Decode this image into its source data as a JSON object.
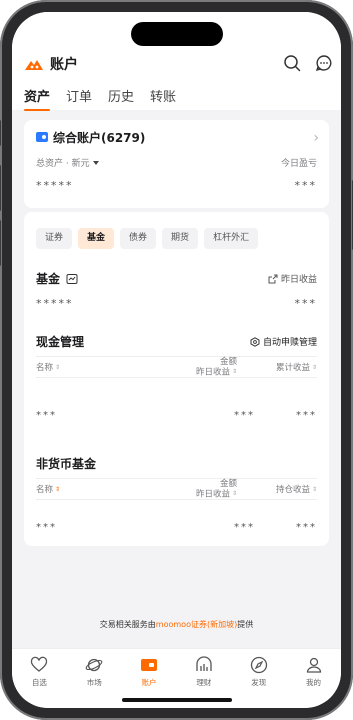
{
  "header": {
    "title": "账户"
  },
  "tabs": [
    {
      "label": "资产",
      "active": true
    },
    {
      "label": "订单"
    },
    {
      "label": "历史"
    },
    {
      "label": "转账"
    }
  ],
  "account": {
    "name": "综合账户(6279)",
    "total_label": "总资产 · 新元",
    "today_pl_label": "今日盈亏",
    "total_value": "*****",
    "today_value": "***"
  },
  "chips": [
    "证券",
    "基金",
    "债券",
    "期货",
    "杠杆外汇"
  ],
  "fund": {
    "title": "基金",
    "yesterday_label": "昨日收益",
    "total_value": "*****",
    "yesterday_value": "***"
  },
  "cash": {
    "title": "现金管理",
    "action": "自动申赎管理",
    "col_name": "名称",
    "col_amount": "金额",
    "col_yesterday": "昨日收益",
    "col_cum": "累计收益",
    "row": {
      "name": "***",
      "amount": "***",
      "cum": "***"
    }
  },
  "nonmoney": {
    "title": "非货币基金",
    "col_name": "名称",
    "col_amount": "金额",
    "col_yesterday": "昨日收益",
    "col_hold": "持仓收益",
    "row": {
      "name": "***",
      "amount": "***",
      "hold": "***"
    }
  },
  "footer": {
    "pre": "交易相关服务由",
    "link": "moomoo证券(新加坡)",
    "post": "提供"
  },
  "tabbar": [
    {
      "label": "自选",
      "icon": "heart-icon"
    },
    {
      "label": "市场",
      "icon": "planet-icon"
    },
    {
      "label": "账户",
      "icon": "account-icon",
      "active": true
    },
    {
      "label": "理财",
      "icon": "wealth-icon"
    },
    {
      "label": "发现",
      "icon": "compass-icon"
    },
    {
      "label": "我的",
      "icon": "person-icon"
    }
  ],
  "colors": {
    "accent": "#ff6a00",
    "wallet": "#2a7bff"
  }
}
